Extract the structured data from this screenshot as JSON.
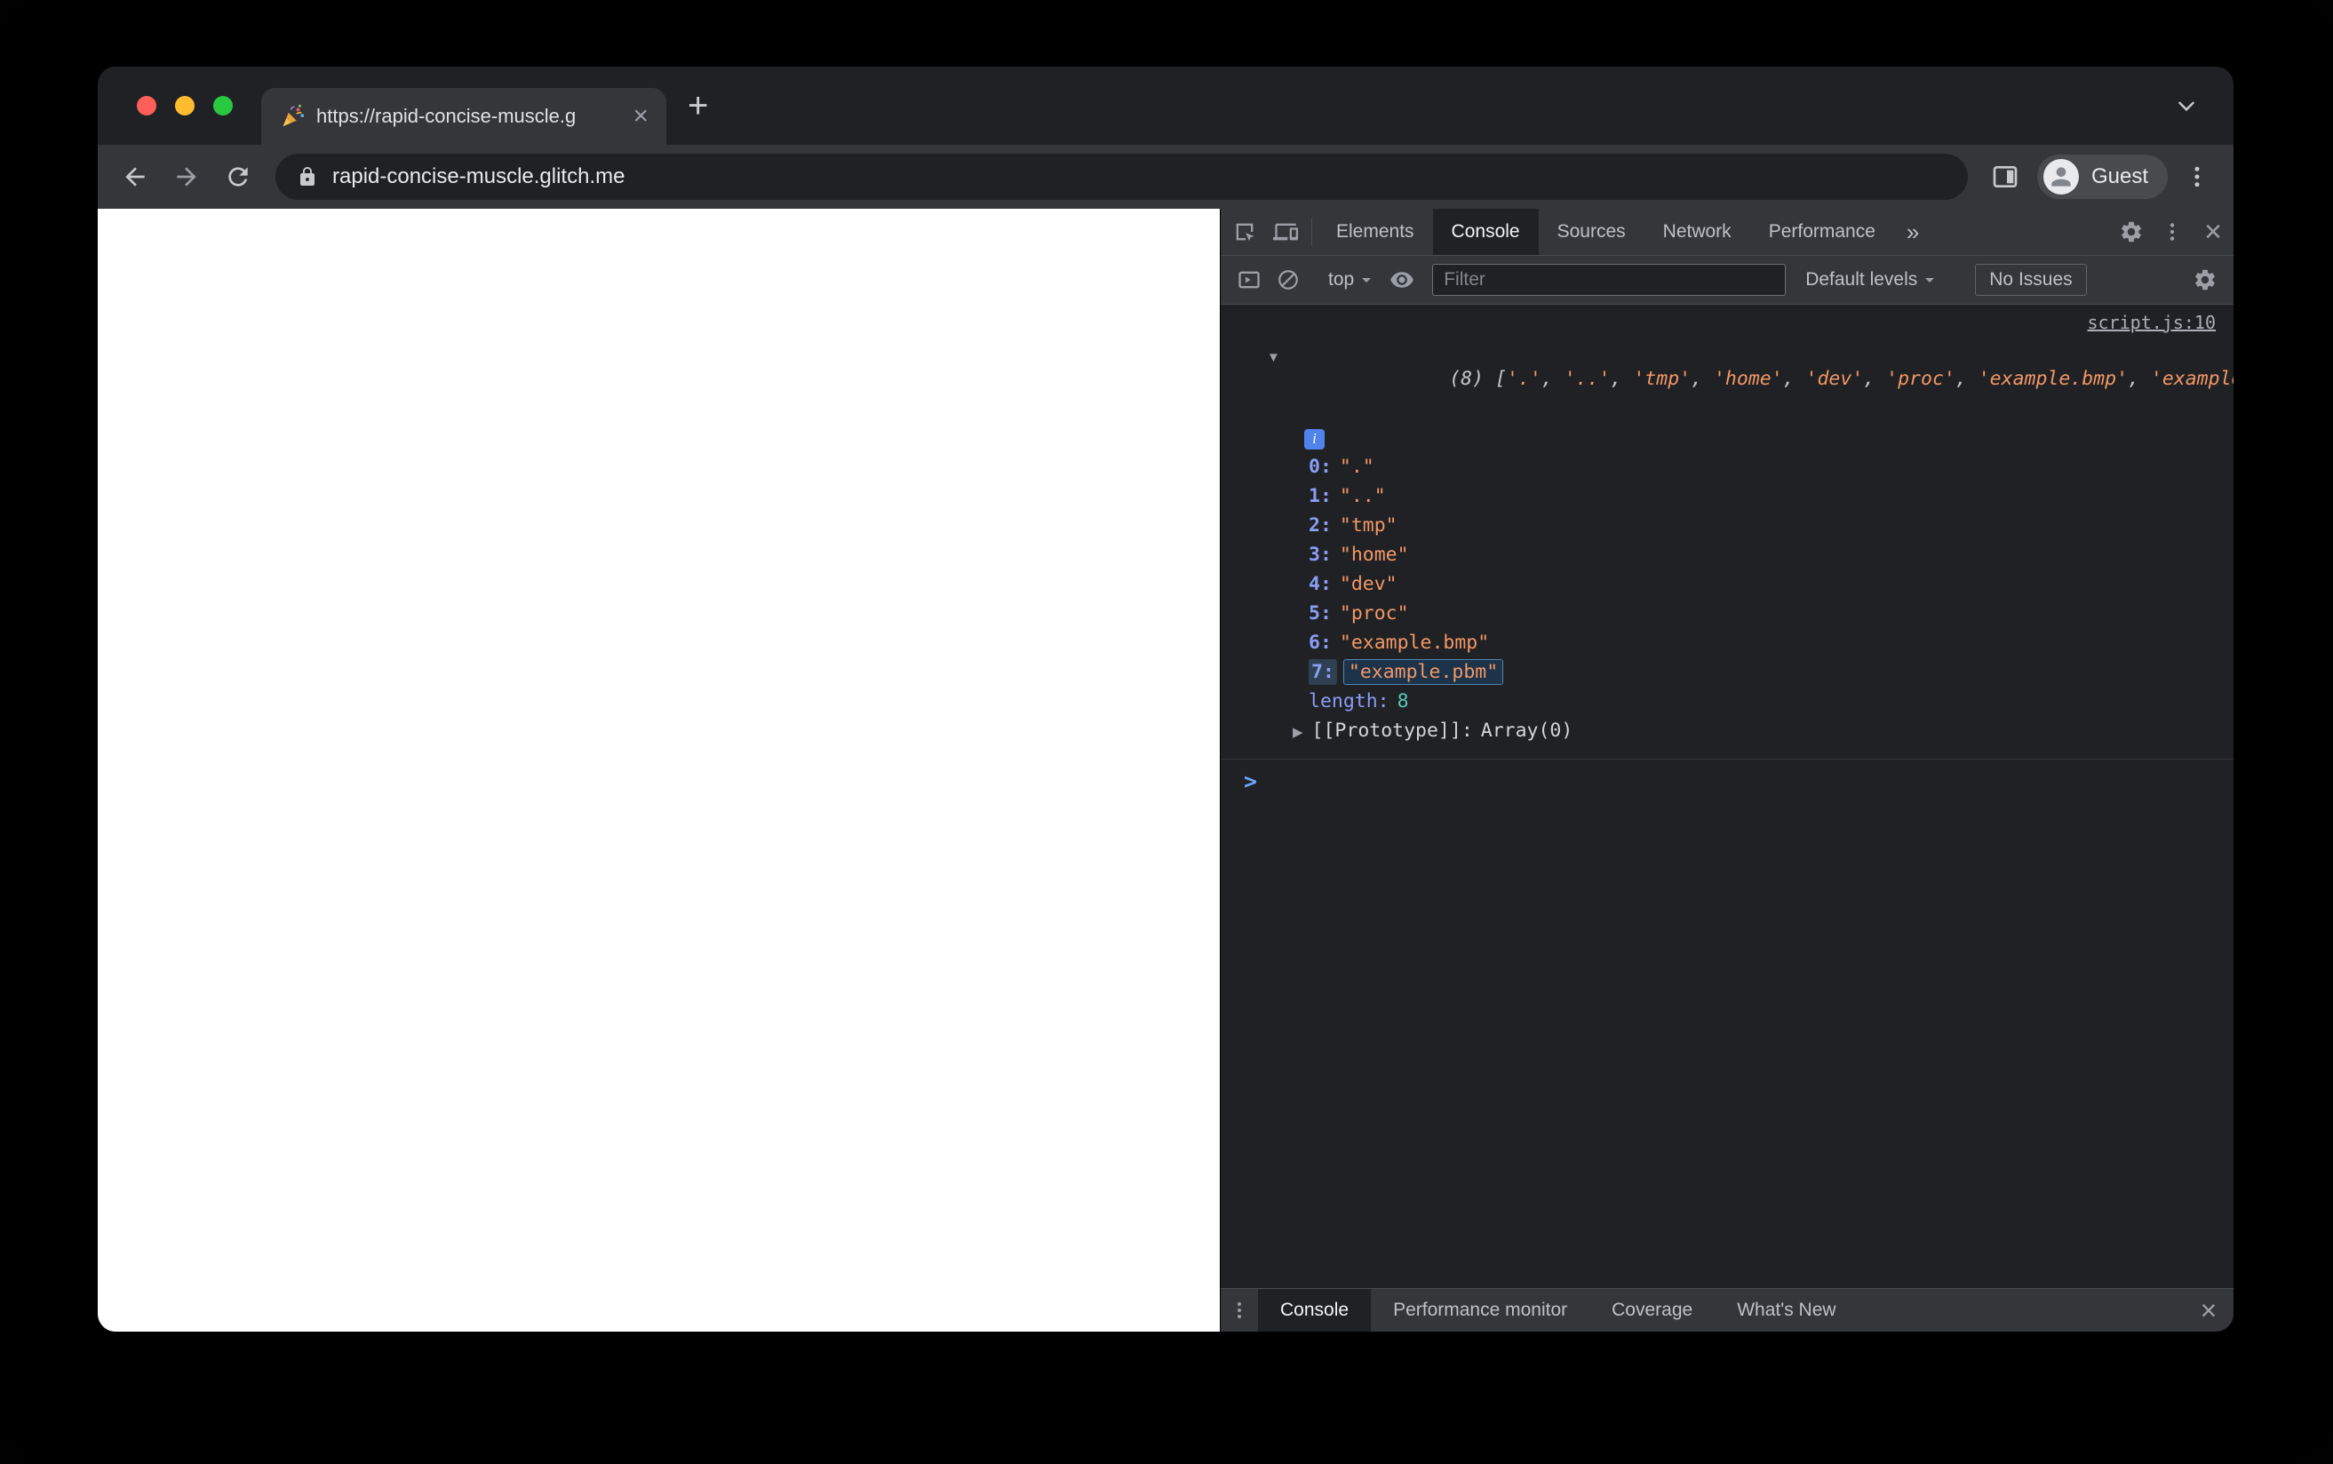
{
  "colors": {
    "accent_blue": "#6ea3f7",
    "string_orange": "#f29766",
    "key_violet": "#8a9ef5",
    "number_teal": "#56c8b8",
    "traffic_red": "#ff5f57",
    "traffic_yellow": "#febc2e",
    "traffic_green": "#28c840"
  },
  "icons": {
    "close": "×",
    "new_tab": "+",
    "more_tabs": "»",
    "caret_down": "▼",
    "caret_right": "▶",
    "prompt_chevron": ">",
    "info": "i",
    "favicon_name": "party-popper"
  },
  "browser": {
    "tab_title": "https://rapid-concise-muscle.g",
    "url": "rapid-concise-muscle.glitch.me",
    "profile_label": "Guest"
  },
  "devtools": {
    "tabs": [
      "Elements",
      "Console",
      "Sources",
      "Network",
      "Performance"
    ],
    "active_tab": "Console",
    "toolbar": {
      "context_selector": "top",
      "filter_placeholder": "Filter",
      "levels_selector": "Default levels",
      "issues_button": "No Issues"
    },
    "console": {
      "source_link": "script.js:10",
      "preview": {
        "prefix": "(8) [",
        "separator": ", ",
        "suffix": "]",
        "items": [
          "'.'",
          "'..'",
          "'tmp'",
          "'home'",
          "'dev'",
          "'proc'",
          "'example.bmp'",
          "'example.pbm'"
        ]
      },
      "rows": [
        {
          "key": "0:",
          "value": "\".\""
        },
        {
          "key": "1:",
          "value": "\"..\""
        },
        {
          "key": "2:",
          "value": "\"tmp\""
        },
        {
          "key": "3:",
          "value": "\"home\""
        },
        {
          "key": "4:",
          "value": "\"dev\""
        },
        {
          "key": "5:",
          "value": "\"proc\""
        },
        {
          "key": "6:",
          "value": "\"example.bmp\""
        },
        {
          "key": "7:",
          "value": "\"example.pbm\""
        }
      ],
      "length_row": {
        "key": "length:",
        "value": "8"
      },
      "prototype_row": {
        "key": "[[Prototype]]:",
        "value": "Array(0)"
      }
    },
    "drawer_tabs": [
      "Console",
      "Performance monitor",
      "Coverage",
      "What's New"
    ],
    "drawer_active_tab": "Console"
  }
}
